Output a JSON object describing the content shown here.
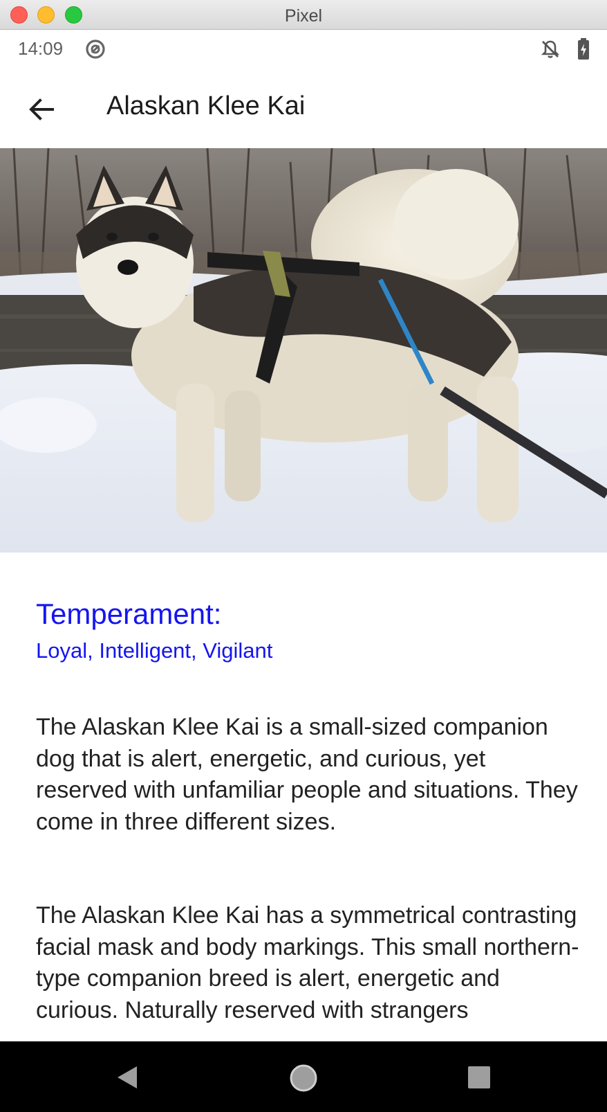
{
  "window": {
    "title": "Pixel"
  },
  "status_bar": {
    "time": "14:09",
    "icons": [
      "sync-icon",
      "bell-off-icon",
      "battery-icon"
    ]
  },
  "app_bar": {
    "title": "Alaskan Klee Kai",
    "back_icon": "arrow-left-icon"
  },
  "hero_image": {
    "subject": "dog-photo"
  },
  "temperament": {
    "heading": "Temperament:",
    "values": "Loyal, Intelligent, Vigilant",
    "color": "#1515f0"
  },
  "description": {
    "paragraph_1": "The Alaskan Klee Kai is a small-sized companion dog that is alert, energetic, and curious, yet reserved with unfamiliar people and situations. They come in three different sizes.",
    "paragraph_2": "The Alaskan Klee Kai has a symmetrical contrasting facial mask and body markings. This small northern-type companion breed is alert, energetic and curious. Naturally reserved with strangers"
  },
  "nav_bar": {
    "icons": [
      "nav-back-icon",
      "nav-home-icon",
      "nav-recent-icon"
    ]
  }
}
